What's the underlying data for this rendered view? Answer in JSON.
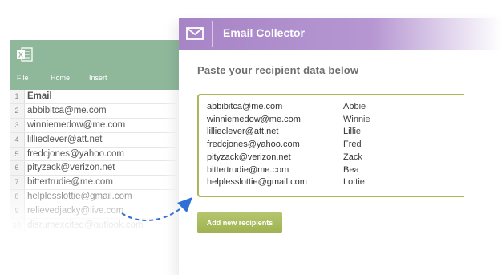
{
  "spreadsheet": {
    "app_icon": "excel-icon",
    "ribbon_tabs": [
      "File",
      "Home",
      "Insert"
    ],
    "rows": [
      {
        "num": "1",
        "value": "Email"
      },
      {
        "num": "2",
        "value": "abbibitca@me.com"
      },
      {
        "num": "3",
        "value": "winniemedow@me.com"
      },
      {
        "num": "4",
        "value": "lillieclever@att.net"
      },
      {
        "num": "5",
        "value": "fredcjones@yahoo.com"
      },
      {
        "num": "6",
        "value": "pityzack@verizon.net"
      },
      {
        "num": "7",
        "value": "bittertrudie@me.com"
      },
      {
        "num": "8",
        "value": "helplesslottie@gmail.com"
      },
      {
        "num": "9",
        "value": "relievedjacky@live.com"
      },
      {
        "num": "10",
        "value": "disrumexcited@outlook.com"
      }
    ]
  },
  "collector": {
    "icon": "mail-icon",
    "title": "Email Collector",
    "instruction": "Paste your recipient data below",
    "recipients": [
      {
        "email": "abbibitca@me.com",
        "name": "Abbie"
      },
      {
        "email": "winniemedow@me.com",
        "name": "Winnie"
      },
      {
        "email": "lillieclever@att.net",
        "name": "Lillie"
      },
      {
        "email": "fredcjones@yahoo.com",
        "name": "Fred"
      },
      {
        "email": "pityzack@verizon.net",
        "name": "Zack"
      },
      {
        "email": "bittertrudie@me.com",
        "name": "Bea"
      },
      {
        "email": "helplesslottie@gmail.com",
        "name": "Lottie"
      }
    ],
    "add_button_label": "Add new recipients"
  },
  "colors": {
    "sheet_toolbar": "#8fb89b",
    "header_purple": "#a784c6",
    "box_border": "#a8b95a",
    "button_green": "#a5b85a",
    "arrow_blue": "#2f6fd6"
  }
}
